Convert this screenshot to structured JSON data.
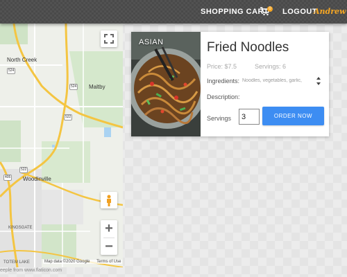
{
  "header": {
    "cart_label": "SHOPPING CART",
    "cart_count": "0",
    "logout_label": "LOGOUT",
    "username": "Andrew"
  },
  "map": {
    "places": [
      "North Creek",
      "Maltby",
      "Woodinville",
      "KINGSGATE",
      "TOTEM LAKE"
    ],
    "route_shields": [
      "524",
      "524",
      "522",
      "522",
      "405"
    ],
    "copyright": "Map data ©2020 Google",
    "terms_label": "Terms of Use",
    "zoom_in_label": "+",
    "zoom_out_label": "−"
  },
  "attribution": "eeple from www.flaticon.com",
  "product": {
    "category": "ASIAN",
    "name": "Fried Noodles",
    "price": "Price: $7.5",
    "servings_info": "Servings: 6",
    "ingredients_label": "Ingredients:",
    "ingredients_value": "Noodles, vegetables, garlic,",
    "description_label": "Description:",
    "servings_label": "Servings",
    "servings_value": "3",
    "order_label": "ORDER NOW"
  },
  "colors": {
    "topbar": "#4a4a4a",
    "accent_orange": "#f5a623",
    "order_button": "#3d8df2"
  }
}
